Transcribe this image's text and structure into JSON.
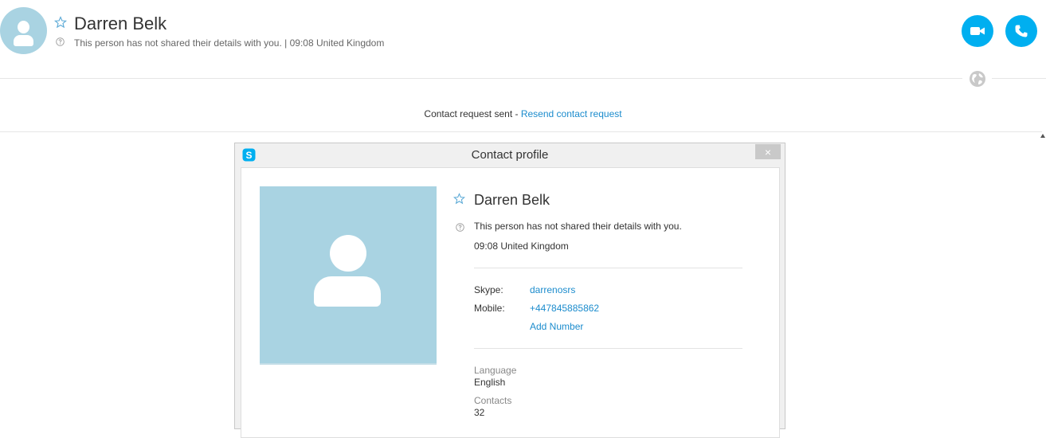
{
  "header": {
    "name": "Darren Belk",
    "status_text": "This person has not shared their details with you.  |  09:08 United Kingdom"
  },
  "contact_request": {
    "text": "Contact request sent - ",
    "link": "Resend contact request"
  },
  "dialog": {
    "title": "Contact profile",
    "close_label": "×",
    "name": "Darren Belk",
    "details_note": "This person has not shared their details with you.",
    "local_time": "09:08 United Kingdom",
    "skype_label": "Skype:",
    "skype_value": "darrenosrs",
    "mobile_label": "Mobile:",
    "mobile_value": "+447845885862",
    "add_number": "Add Number",
    "language_label": "Language",
    "language_value": "English",
    "contacts_label": "Contacts",
    "contacts_value": "32"
  },
  "colors": {
    "accent": "#00aff0",
    "link": "#1c8ccd",
    "avatar_bg": "#a9d3e2"
  },
  "icons": [
    "star-icon",
    "help-icon",
    "video-icon",
    "phone-icon",
    "globe-icon",
    "skype-logo-icon",
    "close-icon"
  ]
}
